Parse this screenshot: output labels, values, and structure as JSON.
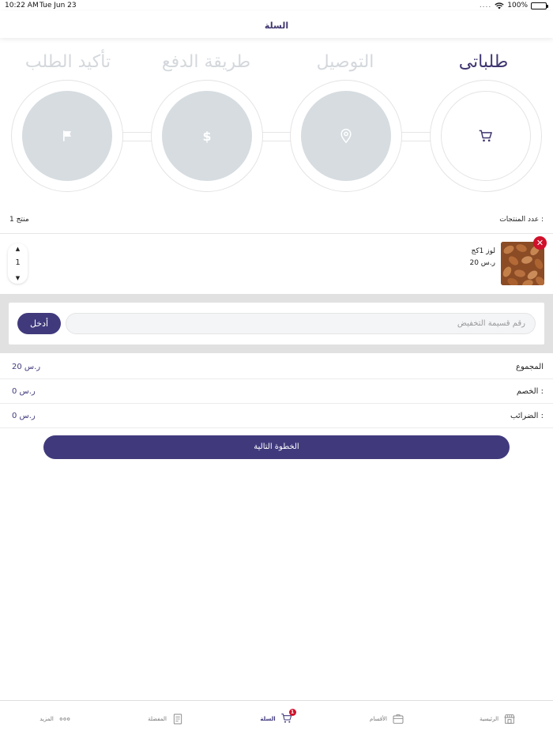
{
  "status_bar": {
    "time": "10:22 AM",
    "date": "Tue Jun 23",
    "battery": "100%",
    "signal_dots": "...."
  },
  "nav": {
    "title": "السلة"
  },
  "steps": [
    {
      "title": "طلباتى",
      "icon": "cart-icon",
      "active": true
    },
    {
      "title": "التوصيل",
      "icon": "location-pin-icon",
      "active": false
    },
    {
      "title": "طريقة الدفع",
      "icon": "dollar-icon",
      "active": false
    },
    {
      "title": "تأكيد الطلب",
      "icon": "flag-icon",
      "active": false
    }
  ],
  "cart": {
    "count_label": "عدد المنتجات :",
    "count_value": "1 منتج",
    "items": [
      {
        "name": "لوز 1كج",
        "price": "20 ر.س",
        "quantity": "1",
        "image": "almonds-photo"
      }
    ]
  },
  "coupon": {
    "placeholder": "رقم قسيمة التخفيض",
    "value": "",
    "apply_label": "أدخل"
  },
  "summary": {
    "total_label": "المجموع",
    "total_value": "20 ر.س",
    "discount_label": "الخصم :",
    "discount_value": "0 ر.س",
    "tax_label": "الضرائب :",
    "tax_value": "0 ر.س"
  },
  "next_button": "الخطوة التالية",
  "tab_bar": {
    "tabs": [
      {
        "label": "الرئيسية",
        "icon": "store-icon"
      },
      {
        "label": "الأقسام",
        "icon": "categories-icon"
      },
      {
        "label": "السلة",
        "icon": "cart-icon",
        "badge": "1",
        "active": true
      },
      {
        "label": "المفضلة",
        "icon": "document-icon"
      },
      {
        "label": "المزيد",
        "icon": "more-dots-icon"
      }
    ]
  },
  "colors": {
    "primary": "#403a7d",
    "inactive_step": "#d6dce0",
    "remove": "#d0112b",
    "coupon_bg": "#e1e1e1"
  }
}
